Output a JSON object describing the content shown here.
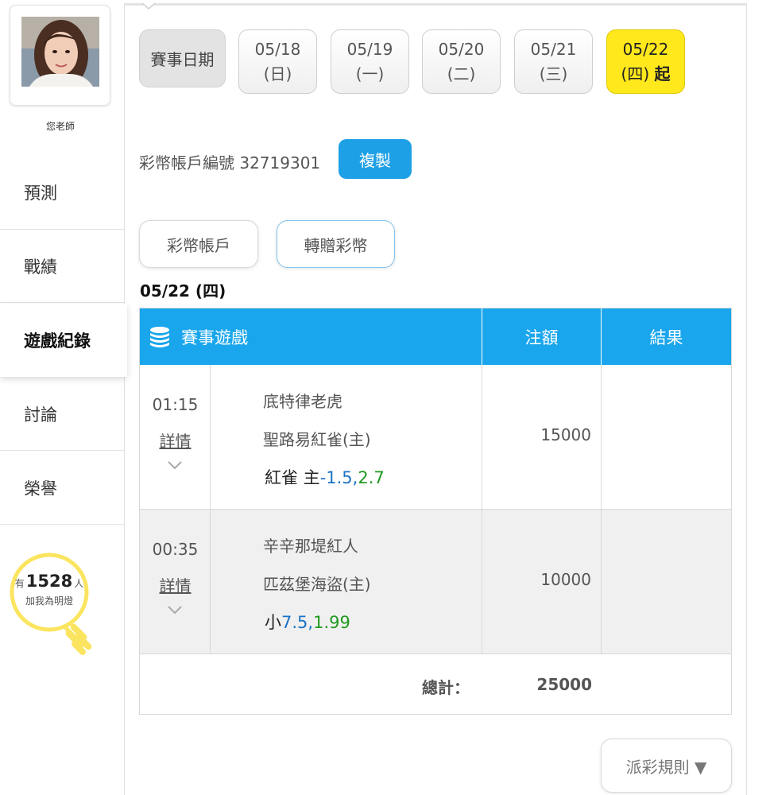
{
  "sidebar": {
    "user_name": "您老師",
    "items": [
      {
        "label": "預測"
      },
      {
        "label": "戰績"
      },
      {
        "label": "遊戲紀錄"
      },
      {
        "label": "討論"
      },
      {
        "label": "榮譽"
      }
    ],
    "fans": {
      "prefix": "有",
      "count": "1528",
      "suffix": "人",
      "caption": "加我為明燈"
    }
  },
  "date_filter": {
    "label": "賽事日期",
    "dates": [
      {
        "date": "05/18",
        "weekday": "(日)"
      },
      {
        "date": "05/19",
        "weekday": "(一)"
      },
      {
        "date": "05/20",
        "weekday": "(二)"
      },
      {
        "date": "05/21",
        "weekday": "(三)"
      },
      {
        "date": "05/22",
        "weekday": "(四)",
        "suffix": "起",
        "selected": true
      }
    ]
  },
  "account": {
    "label": "彩幣帳戶編號 32719301",
    "copy_label": "複製"
  },
  "tabs": {
    "wallet": "彩幣帳戶",
    "gift": "轉贈彩幣"
  },
  "day_heading": "05/22 (四)",
  "table": {
    "headers": {
      "game": "賽事遊戲",
      "bet": "注額",
      "result": "結果"
    },
    "rows": [
      {
        "time": "01:15",
        "detail": "詳情",
        "team_away": "底特律老虎",
        "team_home": "聖路易紅雀(主)",
        "pick_label": "紅雀 主",
        "pick_line": "-1.5,",
        "pick_odds": "2.7",
        "bet": "15000",
        "result": ""
      },
      {
        "time": "00:35",
        "detail": "詳情",
        "team_away": "辛辛那堤紅人",
        "team_home": "匹茲堡海盜(主)",
        "pick_label": "小",
        "pick_line": "7.5,",
        "pick_odds": "1.99",
        "bet": "10000",
        "result": ""
      }
    ],
    "total_label": "總計：",
    "total_value": "25000"
  },
  "rules_button": "派彩規則 ▼",
  "colors": {
    "accent_blue": "#19a6ec",
    "selected_yellow": "#ffe81c",
    "odds_green": "#1e9a1e",
    "line_blue": "#1b73c4",
    "bulb_yellow": "#fbe560"
  }
}
